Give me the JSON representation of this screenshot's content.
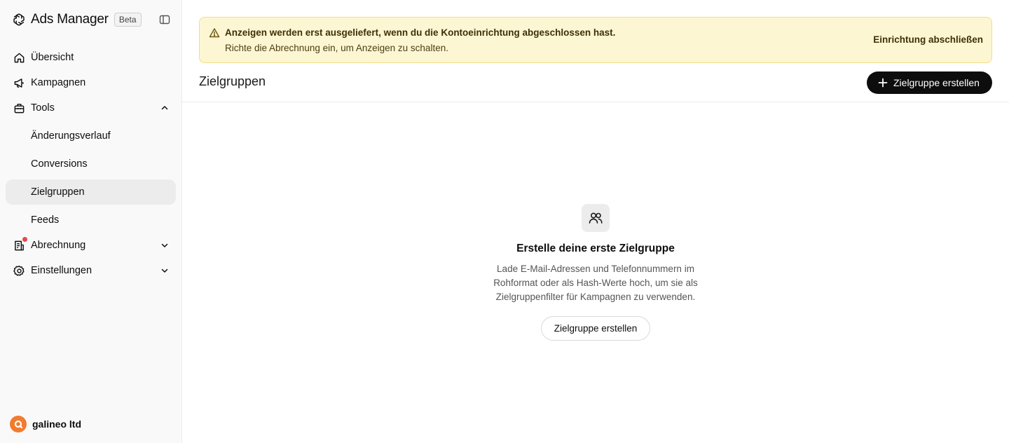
{
  "app": {
    "title": "Ads Manager",
    "badge": "Beta"
  },
  "sidebar": {
    "items": [
      {
        "label": "Übersicht",
        "icon": "home-icon"
      },
      {
        "label": "Kampagnen",
        "icon": "megaphone-icon"
      },
      {
        "label": "Tools",
        "icon": "toolbox-icon",
        "expanded": true
      },
      {
        "label": "Abrechnung",
        "icon": "billing-icon",
        "expanded": false,
        "notification": true
      },
      {
        "label": "Einstellungen",
        "icon": "gear-icon",
        "expanded": false
      }
    ],
    "tools_subitems": [
      {
        "label": "Änderungsverlauf"
      },
      {
        "label": "Conversions"
      },
      {
        "label": "Zielgruppen",
        "active": true
      },
      {
        "label": "Feeds"
      }
    ],
    "account": {
      "name": "galineo ltd"
    }
  },
  "banner": {
    "title": "Anzeigen werden erst ausgeliefert, wenn du die Kontoeinrichtung abgeschlossen hast.",
    "subtitle": "Richte die Abrechnung ein, um Anzeigen zu schalten.",
    "action": "Einrichtung abschließen"
  },
  "page": {
    "title": "Zielgruppen",
    "create_button": "Zielgruppe erstellen"
  },
  "empty_state": {
    "title": "Erstelle deine erste Zielgruppe",
    "description": "Lade E-Mail-Adressen und Telefonnummern im Rohformat oder als Hash-Werte hoch, um sie als Zielgruppenfilter für Kampagnen zu verwenden.",
    "button": "Zielgruppe erstellen"
  },
  "colors": {
    "banner_bg": "#fdf6d2",
    "banner_border": "#f1dd8a",
    "primary_button": "#0d0d0d",
    "notification_dot": "#e5484d",
    "avatar": "#f27b2e"
  }
}
